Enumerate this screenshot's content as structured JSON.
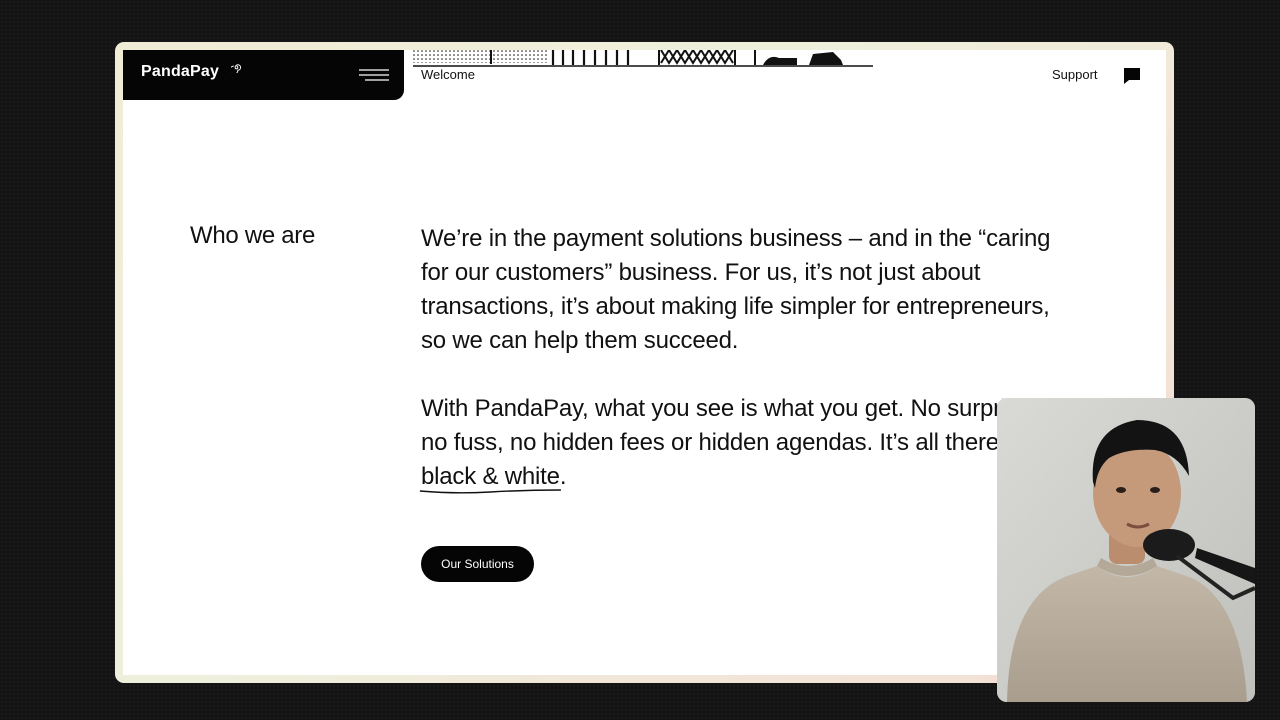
{
  "header": {
    "logo": "PandaPay",
    "welcome": "Welcome",
    "support": "Support"
  },
  "icons": {
    "logo_mark": "swirl-icon",
    "menu": "hamburger-menu-icon",
    "chat": "chat-bubble-icon"
  },
  "section": {
    "title": "Who we are",
    "paragraph_1": "We’re in the payment solutions business – and in the “caring for our customers” business. For us, it’s not just about transactions, it’s about making life simpler for entrepreneurs, so we can help them succeed.",
    "paragraph_2_lead": "With PandaPay, what you see is what you get. No surprises, no fuss, no hidden fees or hidden agendas. It’s all there in ",
    "paragraph_2_highlight": "black & white",
    "paragraph_2_end": "."
  },
  "cta": {
    "label": "Our Solutions"
  },
  "colors": {
    "brand_black": "#050505",
    "page_bg": "#ffffff",
    "frame_gradient_start": "#f1ecd5",
    "frame_gradient_end": "#f3ddd2"
  }
}
